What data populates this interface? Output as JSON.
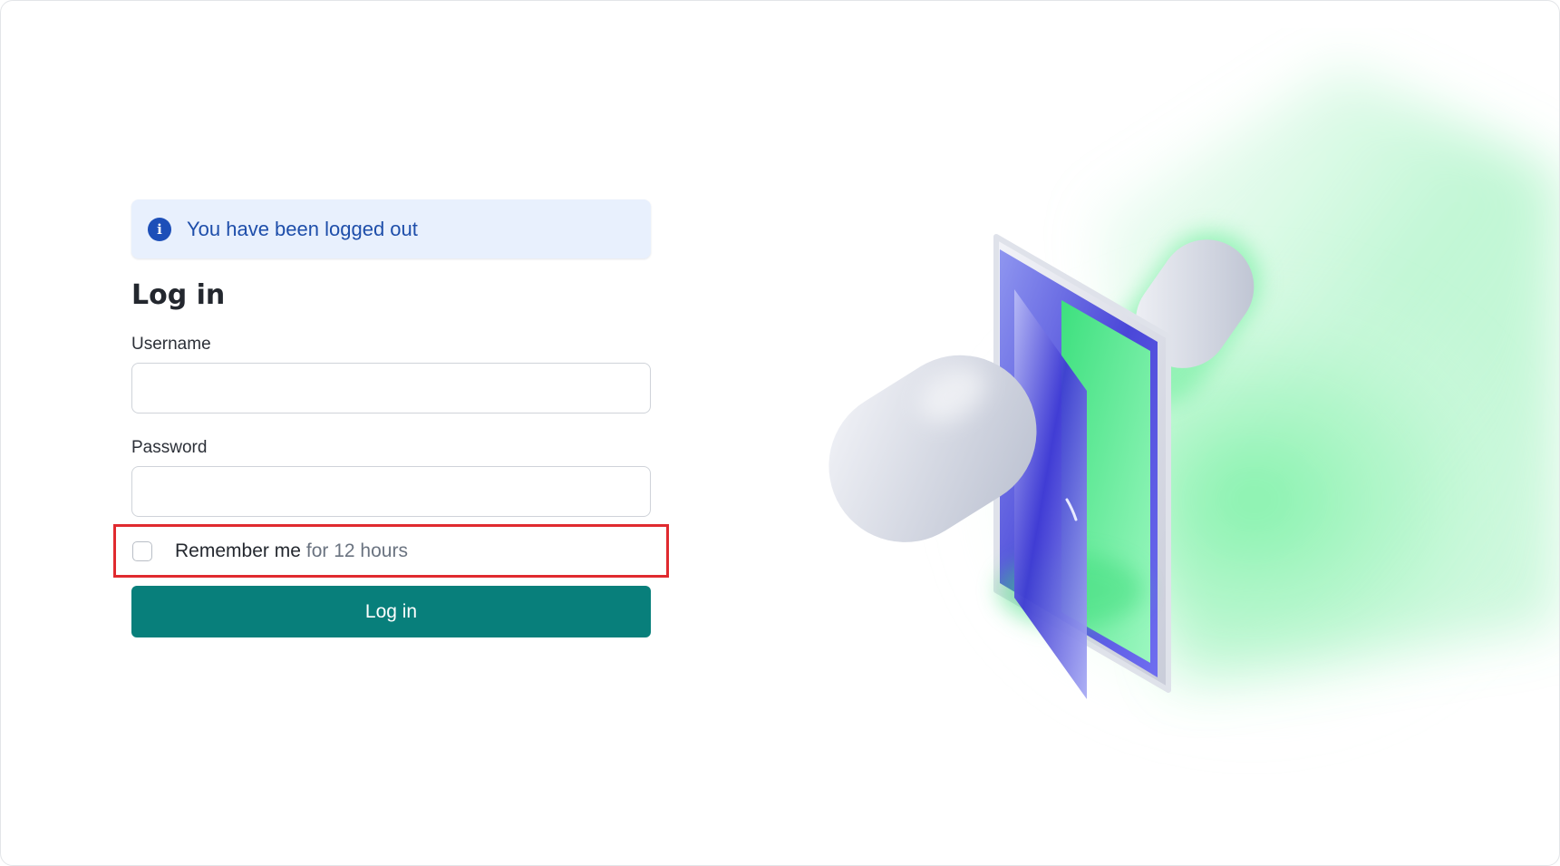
{
  "alert": {
    "icon": "info-icon",
    "icon_glyph": "i",
    "message": "You have been logged out"
  },
  "login": {
    "title": "Log in",
    "username_label": "Username",
    "username_value": "",
    "password_label": "Password",
    "password_value": "",
    "remember_label": "Remember me",
    "remember_suffix": "for 12 hours",
    "remember_checked": false,
    "submit_label": "Log in"
  },
  "colors": {
    "accent": "#087f7b",
    "alert_bg": "#e8f0fd",
    "alert_text": "#1e4eaa",
    "highlight": "#e02a2f"
  }
}
